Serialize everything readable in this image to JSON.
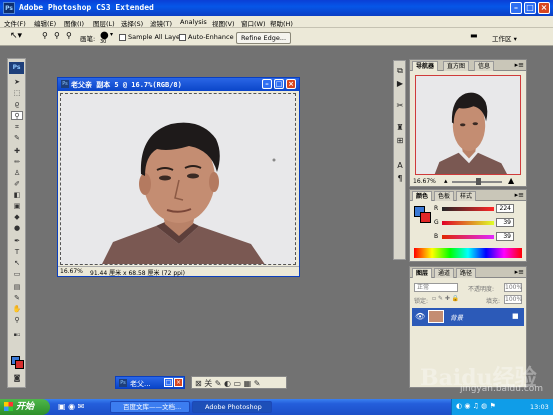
{
  "titlebar": {
    "title": "Adobe Photoshop CS3 Extended",
    "app_icon": "Ps"
  },
  "menubar": [
    "文件(F)",
    "编辑(E)",
    "图像(I)",
    "图层(L)",
    "选择(S)",
    "滤镜(T)",
    "Analysis",
    "视图(V)",
    "窗口(W)",
    "帮助(H)"
  ],
  "options": {
    "brush_label": "画笔:",
    "brush_size": "30",
    "sample_all_layers": "Sample All Layers",
    "auto_enhance": "Auto-Enhance",
    "refine_edge": "Refine Edge...",
    "workspace": "工作区 ▾"
  },
  "tools": {
    "logo": "Ps"
  },
  "document": {
    "title": "老父亲  副本 5 @ 16.7%(RGB/8)",
    "zoom": "16.67%",
    "doc_info": "91.44 厘米 x 68.58 厘米 (72 ppi)"
  },
  "navigator": {
    "tabs": [
      "导航器",
      "直方图",
      "信息"
    ],
    "zoom": "16.67%"
  },
  "color_panel": {
    "tabs": [
      "颜色",
      "色板",
      "样式"
    ],
    "r_label": "R",
    "r_value": "224",
    "g_label": "G",
    "g_value": "39",
    "b_label": "B",
    "b_value": "39",
    "fg_color": "#3c7ad6",
    "bg_color": "#e02727"
  },
  "layers_panel": {
    "tabs": [
      "图层",
      "通道",
      "路径"
    ],
    "blend_mode": "正常",
    "opacity_label": "不透明度:",
    "opacity_value": "100%",
    "lock_label": "锁定:",
    "fill_label": "填充:",
    "fill_value": "100%",
    "layer_name": "背景"
  },
  "minimized": [
    {
      "title": "老父..."
    },
    {
      "title": ""
    }
  ],
  "taskbar": {
    "start": "开始",
    "tasks": [
      "百度文库——文档...",
      "Adobe Photoshop"
    ],
    "clock": "13:03"
  },
  "watermark": {
    "text": "Baidu经验",
    "url": "jingyan.baidu.com"
  }
}
